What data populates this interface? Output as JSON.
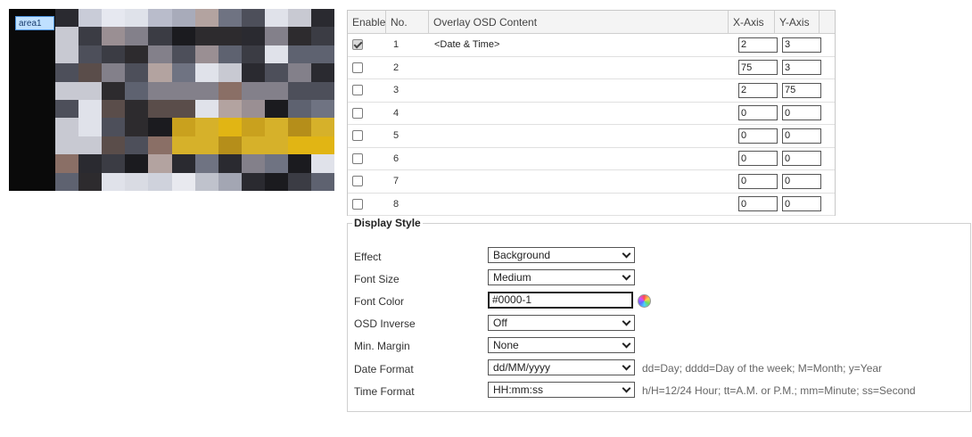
{
  "preview": {
    "area_tag": "area1"
  },
  "osd_table": {
    "headers": {
      "enable": "Enable",
      "no": "No.",
      "content": "Overlay OSD Content",
      "x_axis": "X-Axis",
      "y_axis": "Y-Axis"
    },
    "rows": [
      {
        "enabled": true,
        "no": "1",
        "content": "<Date & Time>",
        "x": "2",
        "y": "3"
      },
      {
        "enabled": false,
        "no": "2",
        "content": "",
        "x": "75",
        "y": "3"
      },
      {
        "enabled": false,
        "no": "3",
        "content": "",
        "x": "2",
        "y": "75"
      },
      {
        "enabled": false,
        "no": "4",
        "content": "",
        "x": "0",
        "y": "0"
      },
      {
        "enabled": false,
        "no": "5",
        "content": "",
        "x": "0",
        "y": "0"
      },
      {
        "enabled": false,
        "no": "6",
        "content": "",
        "x": "0",
        "y": "0"
      },
      {
        "enabled": false,
        "no": "7",
        "content": "",
        "x": "0",
        "y": "0"
      },
      {
        "enabled": false,
        "no": "8",
        "content": "",
        "x": "0",
        "y": "0"
      }
    ]
  },
  "display_style": {
    "legend": "Display Style",
    "effect": {
      "label": "Effect",
      "value": "Background"
    },
    "font_size": {
      "label": "Font Size",
      "value": "Medium"
    },
    "font_color": {
      "label": "Font Color",
      "value": "#0000-1"
    },
    "osd_inverse": {
      "label": "OSD Inverse",
      "value": "Off"
    },
    "min_margin": {
      "label": "Min. Margin",
      "value": "None"
    },
    "date_format": {
      "label": "Date Format",
      "value": "dd/MM/yyyy",
      "hint": "dd=Day; dddd=Day of the week; M=Month; y=Year"
    },
    "time_format": {
      "label": "Time Format",
      "value": "HH:mm:ss",
      "hint": "h/H=12/24 Hour; tt=A.M. or P.M.; mm=Minute; ss=Second"
    }
  }
}
